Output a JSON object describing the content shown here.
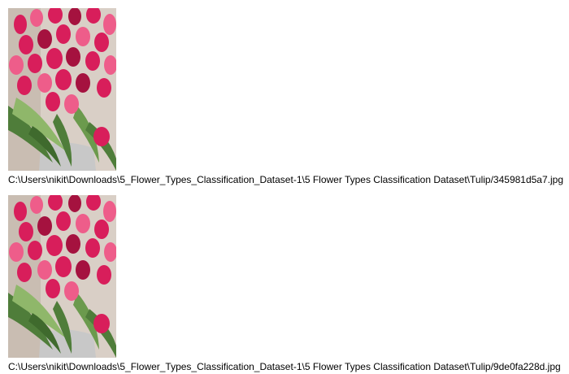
{
  "gallery": {
    "items": [
      {
        "image_alt": "tulip-bouquet-photo",
        "path": "C:\\Users\\nikit\\Downloads\\5_Flower_Types_Classification_Dataset-1\\5 Flower Types Classification Dataset\\Tulip/345981d5a7.jpg"
      },
      {
        "image_alt": "tulip-bouquet-photo",
        "path": "C:\\Users\\nikit\\Downloads\\5_Flower_Types_Classification_Dataset-1\\5 Flower Types Classification Dataset\\Tulip/9de0fa228d.jpg"
      }
    ]
  },
  "colors": {
    "petal": "#d81e5b",
    "petal_dark": "#a5123f",
    "petal_light": "#ee5d8a",
    "leaf": "#4f7d3a",
    "leaf_light": "#8fb76a",
    "background": "#d9cfc6",
    "vase": "#c8c8c8"
  }
}
